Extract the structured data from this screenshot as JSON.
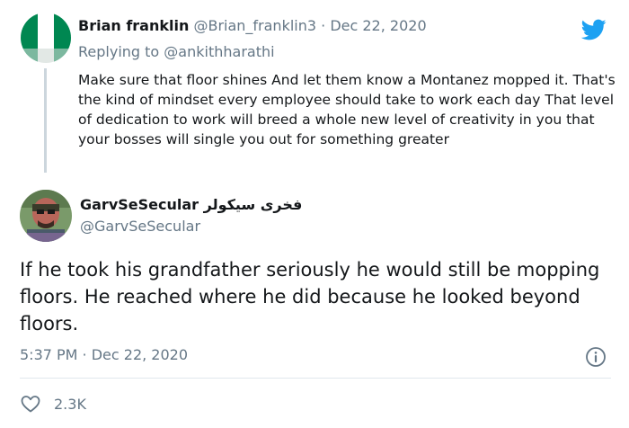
{
  "reply_tweet": {
    "author_name": "Brian franklin",
    "handle": "@Brian_franklin3",
    "separator": "·",
    "date": "Dec 22, 2020",
    "replying_label": "Replying to",
    "replying_to": "@ankithharathi",
    "text": "Make sure that floor shines And let them know a Montanez mopped it. That's the kind of mindset every employee should take to work each day That level of dedication to work will breed a whole new level of creativity in you that your bosses will single you out for something greater",
    "avatar_icon": "nigeria-flag-avatar"
  },
  "main_tweet": {
    "author_name": "GarvSeSecular",
    "author_name_suffix": "فخری سیکولر",
    "handle": "@GarvSeSecular",
    "text": "If he took his grandfather seriously he would still be mopping floors. He reached where he did because he looked beyond floors.",
    "timestamp": "5:37 PM · Dec 22, 2020",
    "likes": "2.3K",
    "avatar_icon": "portrait-avatar"
  },
  "icons": {
    "brand": "twitter-bird-icon",
    "info": "info-icon",
    "like": "heart-icon"
  },
  "colors": {
    "brand": "#1da1f2",
    "text": "#14171a",
    "muted": "#657786",
    "flag_green": "#008751"
  }
}
